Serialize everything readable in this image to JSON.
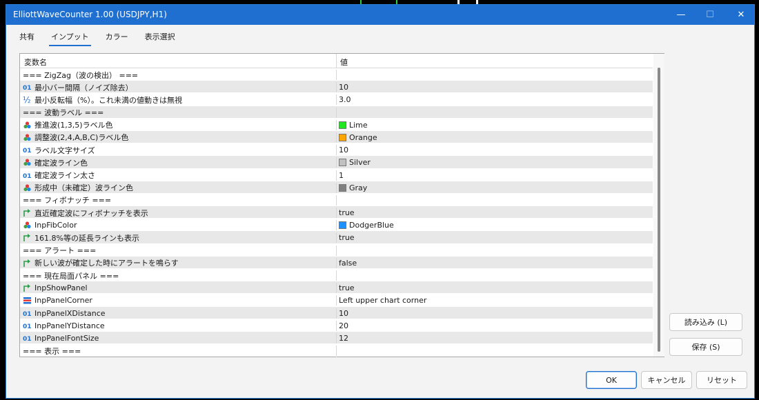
{
  "window": {
    "title": "ElliottWaveCounter 1.00 (USDJPY,H1)",
    "controls": {
      "minimize": "—",
      "maximize": "☐",
      "close": "✕"
    }
  },
  "tabs": [
    {
      "label": "共有",
      "active": false
    },
    {
      "label": "インプット",
      "active": true
    },
    {
      "label": "カラー",
      "active": false
    },
    {
      "label": "表示選択",
      "active": false
    }
  ],
  "grid": {
    "headers": {
      "name": "変数名",
      "value": "値"
    },
    "rows": [
      {
        "icon": "none",
        "name": "=== ZigZag（波の検出） ===",
        "value": ""
      },
      {
        "icon": "int-icon",
        "name": "最小バー間隔（ノイズ除去）",
        "value": "10"
      },
      {
        "icon": "double-icon",
        "name": "最小反転幅（%）。これ未満の値動きは無視",
        "value": "3.0"
      },
      {
        "icon": "none",
        "name": "=== 波動ラベル ===",
        "value": ""
      },
      {
        "icon": "color-icon",
        "name": "推進波(1,3,5)ラベル色",
        "value": "Lime",
        "color": "#22e622"
      },
      {
        "icon": "color-icon",
        "name": "調整波(2,4,A,B,C)ラベル色",
        "value": "Orange",
        "color": "#ffa500"
      },
      {
        "icon": "int-icon",
        "name": "ラベル文字サイズ",
        "value": "10"
      },
      {
        "icon": "color-icon",
        "name": "確定波ライン色",
        "value": "Silver",
        "color": "#c0c0c0"
      },
      {
        "icon": "int-icon",
        "name": "確定波ライン太さ",
        "value": "1"
      },
      {
        "icon": "color-icon",
        "name": "形成中（未確定）波ライン色",
        "value": "Gray",
        "color": "#808080"
      },
      {
        "icon": "none",
        "name": "=== フィボナッチ ===",
        "value": ""
      },
      {
        "icon": "bool-icon",
        "name": "直近確定波にフィボナッチを表示",
        "value": "true"
      },
      {
        "icon": "color-icon",
        "name": "InpFibColor",
        "value": "DodgerBlue",
        "color": "#1e90ff"
      },
      {
        "icon": "bool-icon",
        "name": "161.8%等の延長ラインも表示",
        "value": "true"
      },
      {
        "icon": "none",
        "name": "=== アラート ===",
        "value": ""
      },
      {
        "icon": "bool-icon",
        "name": "新しい波が確定した時にアラートを鳴らす",
        "value": "false"
      },
      {
        "icon": "none",
        "name": "=== 現在局面パネル ===",
        "value": ""
      },
      {
        "icon": "bool-icon",
        "name": "InpShowPanel",
        "value": "true"
      },
      {
        "icon": "enum-icon",
        "name": "InpPanelCorner",
        "value": "Left upper chart corner"
      },
      {
        "icon": "int-icon",
        "name": "InpPanelXDistance",
        "value": "10"
      },
      {
        "icon": "int-icon",
        "name": "InpPanelYDistance",
        "value": "20"
      },
      {
        "icon": "int-icon",
        "name": "InpPanelFontSize",
        "value": "12"
      },
      {
        "icon": "none",
        "name": "=== 表示 ===",
        "value": ""
      }
    ]
  },
  "buttons": {
    "load": "読み込み (L)",
    "save": "保存 (S)",
    "ok": "OK",
    "cancel": "キャンセル",
    "reset": "リセット"
  },
  "colors": {
    "accent": "#1f6fd1",
    "row_alt": "#e8e8e8"
  }
}
